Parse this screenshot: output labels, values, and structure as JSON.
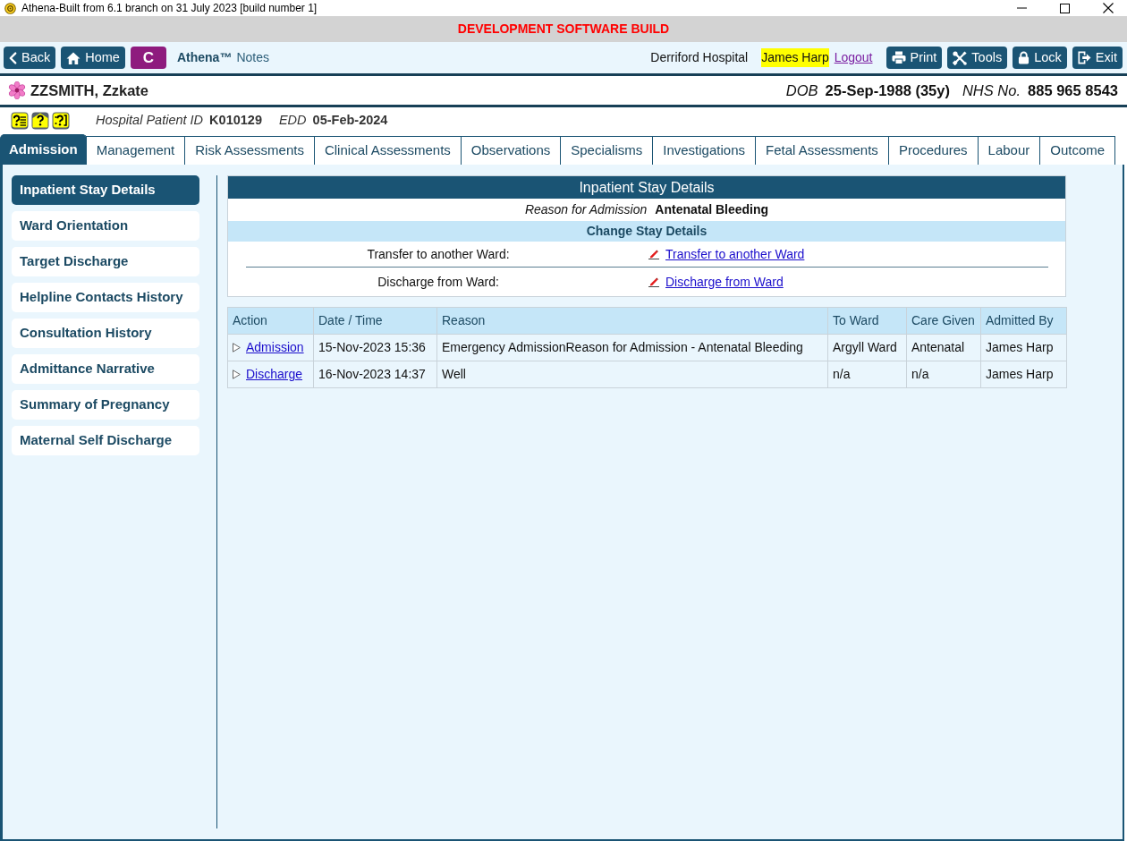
{
  "window": {
    "title": "Athena-Built from 6.1 branch on 31 July 2023 [build number 1]"
  },
  "banner": {
    "text": "DEVELOPMENT SOFTWARE BUILD"
  },
  "toolbar": {
    "nav_buttons": [
      {
        "kind": "back",
        "label": "Back"
      },
      {
        "kind": "home",
        "label": "Home"
      },
      {
        "kind": "letter",
        "label": "C"
      }
    ],
    "app_name": "Athena™",
    "app_module": "Notes",
    "site": "Derriford Hospital",
    "user": "James Harp",
    "logout": "Logout",
    "action_buttons": [
      {
        "kind": "print",
        "label": "Print"
      },
      {
        "kind": "tools",
        "label": "Tools"
      },
      {
        "kind": "lock",
        "label": "Lock"
      },
      {
        "kind": "exit",
        "label": "Exit"
      }
    ]
  },
  "patient": {
    "name": "ZZSMITH, Zzkate",
    "dob_label": "DOB",
    "dob": "25-Sep-1988 (35y)",
    "nhs_label": "NHS No.",
    "nhs_number": "885 965 8543",
    "hospital_id_label": "Hospital Patient ID",
    "hospital_id": "K010129",
    "edd_label": "EDD",
    "edd": "05-Feb-2024"
  },
  "tabs": [
    {
      "label": "Admission",
      "selected": true
    },
    {
      "label": "Management",
      "selected": false
    },
    {
      "label": "Risk Assessments",
      "selected": false
    },
    {
      "label": "Clinical Assessments",
      "selected": false
    },
    {
      "label": "Observations",
      "selected": false
    },
    {
      "label": "Specialisms",
      "selected": false
    },
    {
      "label": "Investigations",
      "selected": false
    },
    {
      "label": "Fetal Assessments",
      "selected": false
    },
    {
      "label": "Procedures",
      "selected": false
    },
    {
      "label": "Labour",
      "selected": false
    },
    {
      "label": "Outcome",
      "selected": false
    }
  ],
  "sidebar": {
    "items": [
      {
        "label": "Inpatient Stay Details",
        "selected": true
      },
      {
        "label": "Ward Orientation",
        "selected": false
      },
      {
        "label": "Target Discharge",
        "selected": false
      },
      {
        "label": "Helpline Contacts History",
        "selected": false
      },
      {
        "label": "Consultation History",
        "selected": false
      },
      {
        "label": "Admittance Narrative",
        "selected": false
      },
      {
        "label": "Summary of Pregnancy",
        "selected": false
      },
      {
        "label": "Maternal Self Discharge",
        "selected": false
      }
    ]
  },
  "stay_panel": {
    "title": "Inpatient Stay Details",
    "reason_label": "Reason for Admission",
    "reason": "Antenatal Bleeding",
    "section_title": "Change Stay Details",
    "actions": [
      {
        "label": "Transfer to another Ward:",
        "link": "Transfer to another Ward"
      },
      {
        "label": "Discharge from Ward:",
        "link": "Discharge from Ward"
      }
    ]
  },
  "table": {
    "columns": [
      "Action",
      "Date / Time",
      "Reason",
      "To Ward",
      "Care Given",
      "Admitted By"
    ],
    "rows": [
      {
        "cells": [
          "Admission",
          "15-Nov-2023 15:36",
          "Emergency AdmissionReason for Admission - Antenatal Bleeding",
          "Argyll Ward",
          "Antenatal",
          "James Harp"
        ]
      },
      {
        "cells": [
          "Discharge",
          "16-Nov-2023 14:37",
          "Well",
          "n/a",
          "n/a",
          "James Harp"
        ]
      }
    ]
  }
}
